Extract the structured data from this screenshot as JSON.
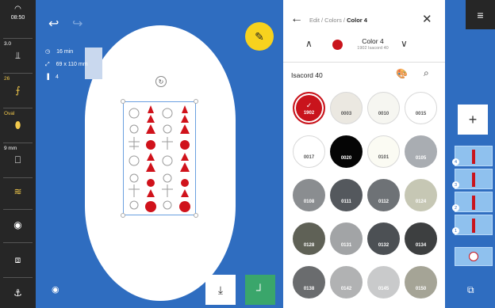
{
  "left_toolbar": {
    "time": "08:50",
    "tension_value": "3.0",
    "presser_value": "26",
    "hoop_label": "Oval",
    "stitch_width": "9 mm"
  },
  "canvas": {
    "info_time": "16 min",
    "info_size": "69 x 110 mm",
    "info_colors": "4"
  },
  "panel": {
    "breadcrumb_prefix": "Edit / Colors / ",
    "breadcrumb_current": "Color 4",
    "current_color_name": "Color 4",
    "current_color_sub": "1902 Isacord 40",
    "current_color_hex": "#c9141c",
    "brand_title": "Isacord 40"
  },
  "swatches": [
    {
      "code": "1902",
      "hex": "#c9141c",
      "text": "#ffffff",
      "selected": true
    },
    {
      "code": "0003",
      "hex": "#ebe8e1",
      "text": "#555555"
    },
    {
      "code": "0010",
      "hex": "#f6f6f1",
      "text": "#555555"
    },
    {
      "code": "0015",
      "hex": "#ffffff",
      "text": "#555555"
    },
    {
      "code": "0017",
      "hex": "#ffffff",
      "text": "#555555"
    },
    {
      "code": "0020",
      "hex": "#050505",
      "text": "#ffffff"
    },
    {
      "code": "0101",
      "hex": "#fbfbf3",
      "text": "#555555"
    },
    {
      "code": "0105",
      "hex": "#a9adb2",
      "text": "#ffffff"
    },
    {
      "code": "0108",
      "hex": "#8a8d90",
      "text": "#ffffff"
    },
    {
      "code": "0111",
      "hex": "#54585d",
      "text": "#ffffff"
    },
    {
      "code": "0112",
      "hex": "#6e7276",
      "text": "#ffffff"
    },
    {
      "code": "0124",
      "hex": "#c6c7b4",
      "text": "#ffffff"
    },
    {
      "code": "0128",
      "hex": "#5f6156",
      "text": "#ffffff"
    },
    {
      "code": "0131",
      "hex": "#a2a4a6",
      "text": "#ffffff"
    },
    {
      "code": "0132",
      "hex": "#4c5054",
      "text": "#ffffff"
    },
    {
      "code": "0134",
      "hex": "#3d3f40",
      "text": "#ffffff"
    },
    {
      "code": "0138",
      "hex": "#6a6c6e",
      "text": "#ffffff"
    },
    {
      "code": "0142",
      "hex": "#b1b2b3",
      "text": "#ffffff"
    },
    {
      "code": "0145",
      "hex": "#c9cacb",
      "text": "#ffffff"
    },
    {
      "code": "0150",
      "hex": "#a5a496",
      "text": "#ffffff"
    }
  ],
  "layers": [
    {
      "number": "4"
    },
    {
      "number": "3"
    },
    {
      "number": "2"
    },
    {
      "number": "1"
    }
  ],
  "icons": {
    "back": "back-arrow-icon",
    "close": "close-icon",
    "search": "search-icon",
    "palette": "palette-icon",
    "menu": "menu-icon",
    "add": "plus-icon"
  }
}
